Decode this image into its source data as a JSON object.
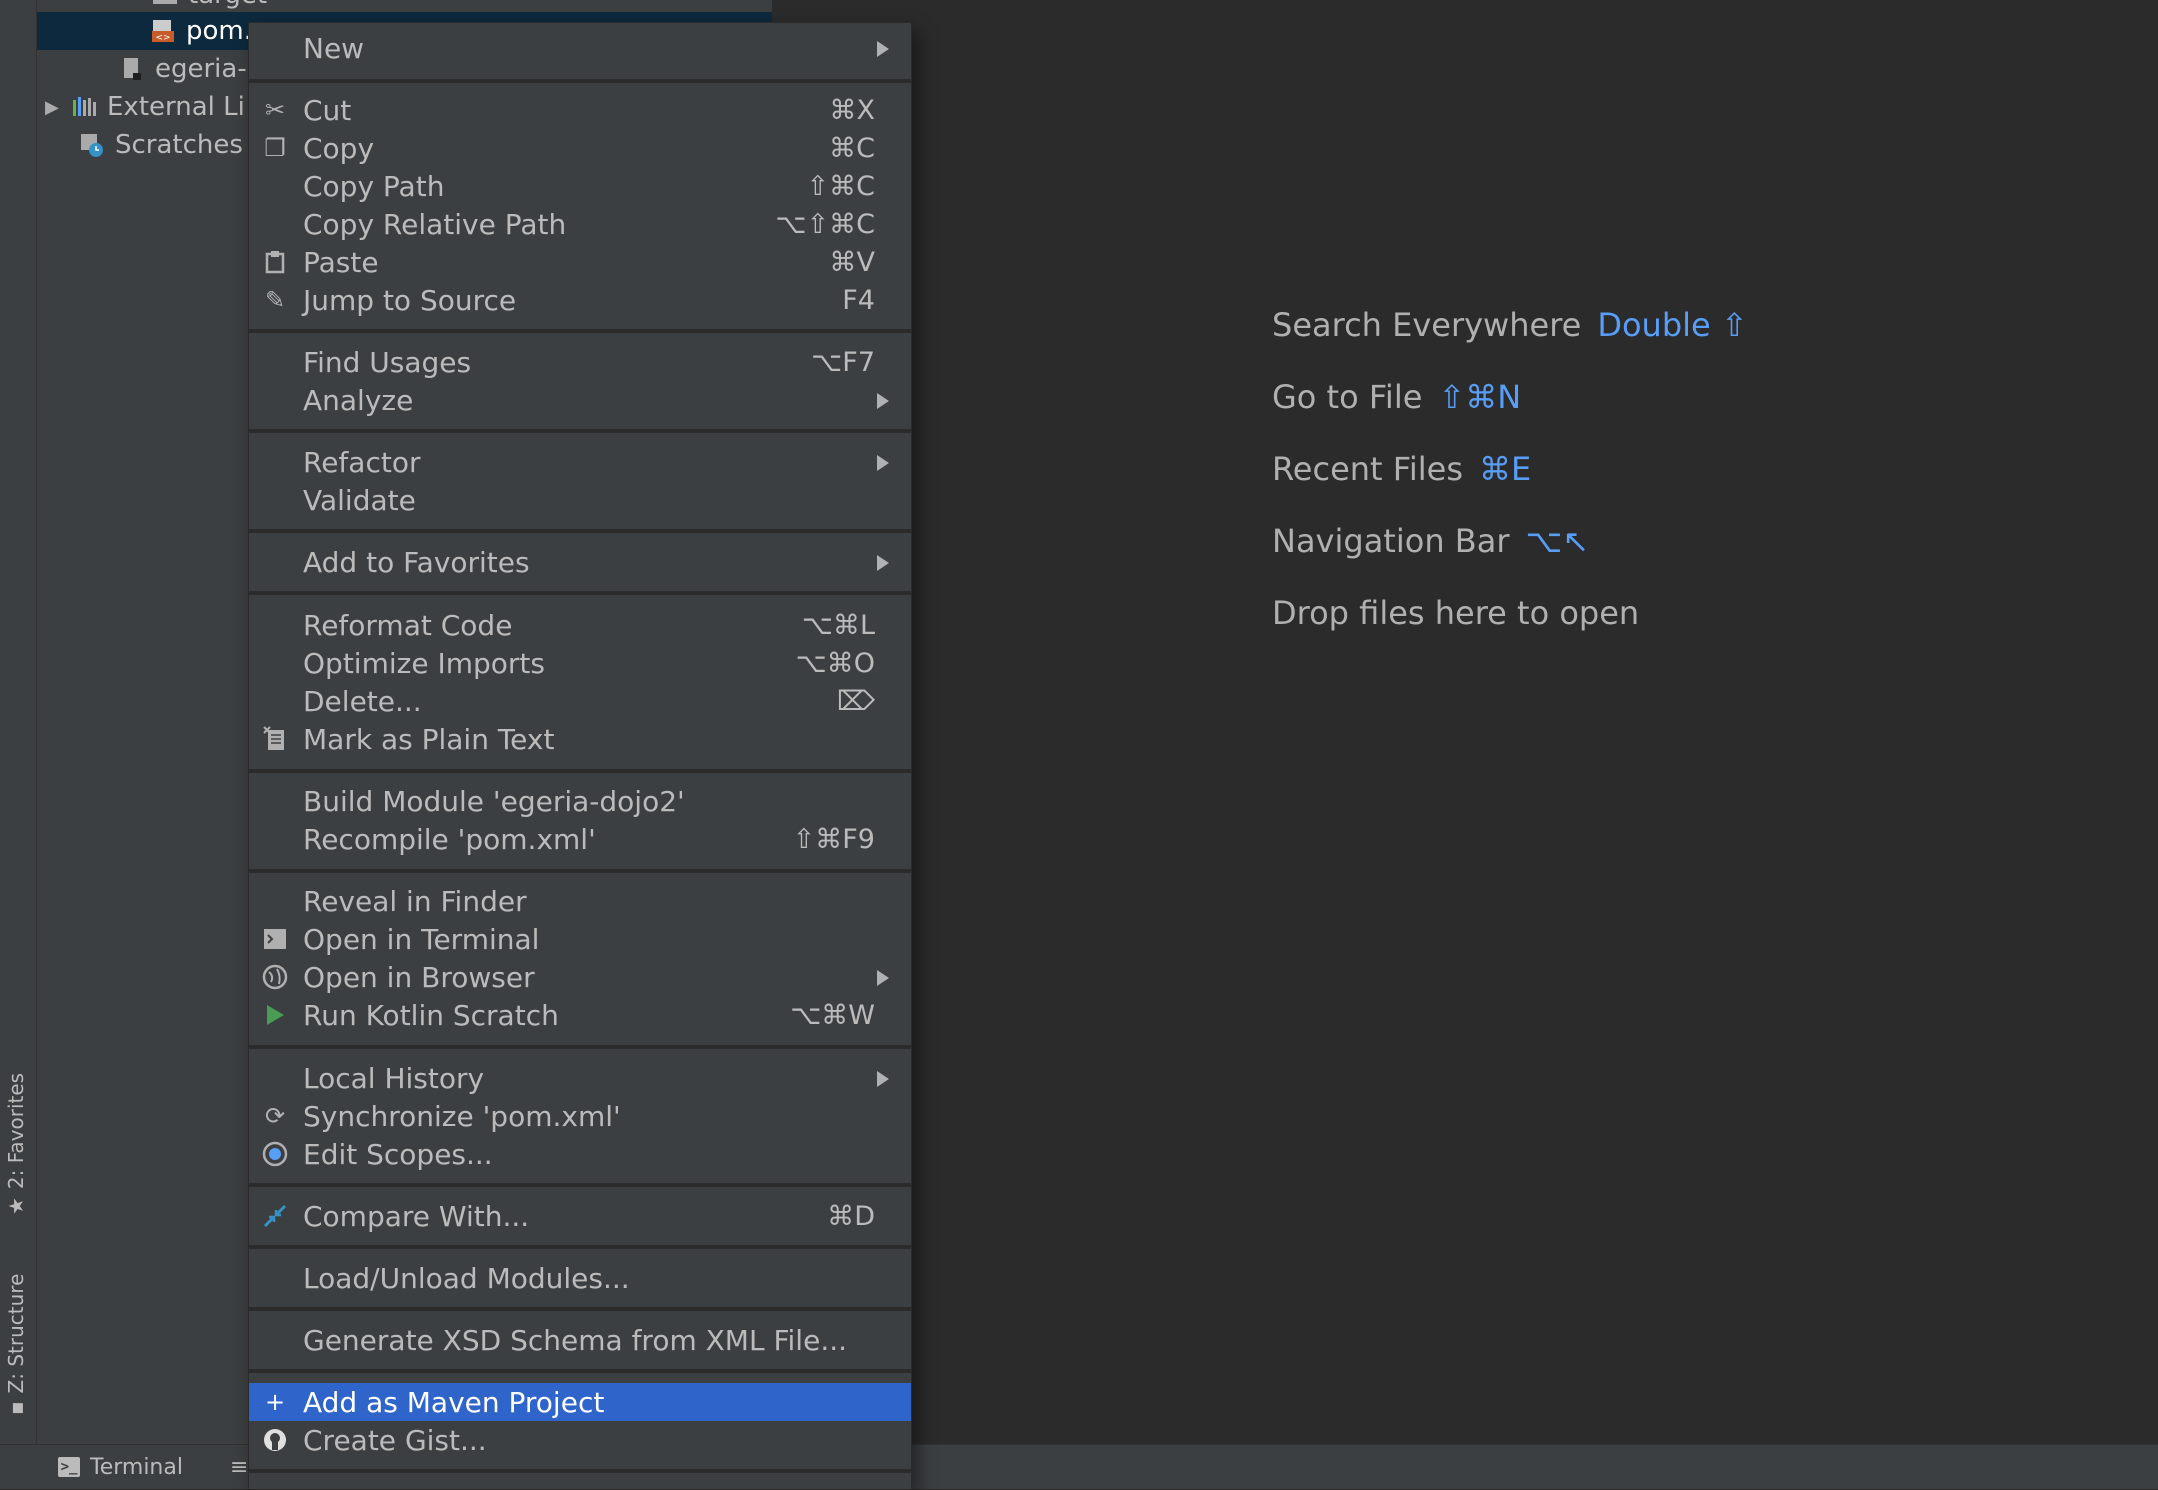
{
  "tool_strip": {
    "favorites_label": "2: Favorites",
    "structure_label": "Z: Structure"
  },
  "project_tree": {
    "items": [
      {
        "label": "target",
        "icon": "folder-icon"
      },
      {
        "label": "pom.",
        "icon": "maven-pom-icon"
      },
      {
        "label": "egeria-",
        "icon": "module-file-icon"
      },
      {
        "label": "External Li",
        "icon": "library-icon"
      },
      {
        "label": "Scratches",
        "icon": "scratches-icon"
      }
    ]
  },
  "context_menu": {
    "items": [
      {
        "label": "New",
        "submenu": true
      },
      {
        "label": "Cut",
        "shortcut": "⌘X",
        "icon": "scissors-icon"
      },
      {
        "label": "Copy",
        "shortcut": "⌘C",
        "icon": "copy-icon"
      },
      {
        "label": "Copy Path",
        "shortcut": "⇧⌘C"
      },
      {
        "label": "Copy Relative Path",
        "shortcut": "⌥⇧⌘C"
      },
      {
        "label": "Paste",
        "shortcut": "⌘V",
        "icon": "clipboard-icon"
      },
      {
        "label": "Jump to Source",
        "shortcut": "F4",
        "icon": "pencil-icon"
      },
      {
        "label": "Find Usages",
        "shortcut": "⌥F7"
      },
      {
        "label": "Analyze",
        "submenu": true
      },
      {
        "label": "Refactor",
        "submenu": true
      },
      {
        "label": "Validate"
      },
      {
        "label": "Add to Favorites",
        "submenu": true
      },
      {
        "label": "Reformat Code",
        "shortcut": "⌥⌘L"
      },
      {
        "label": "Optimize Imports",
        "shortcut": "⌥⌘O"
      },
      {
        "label": "Delete...",
        "shortcut": "⌦"
      },
      {
        "label": "Mark as Plain Text",
        "icon": "plain-text-icon"
      },
      {
        "label": "Build Module 'egeria-dojo2'"
      },
      {
        "label": "Recompile 'pom.xml'",
        "shortcut": "⇧⌘F9"
      },
      {
        "label": "Reveal in Finder"
      },
      {
        "label": "Open in Terminal",
        "icon": "terminal-icon"
      },
      {
        "label": "Open in Browser",
        "submenu": true,
        "icon": "globe-icon"
      },
      {
        "label": "Run Kotlin Scratch",
        "shortcut": "⌥⌘W",
        "icon": "run-icon"
      },
      {
        "label": "Local History",
        "submenu": true
      },
      {
        "label": "Synchronize 'pom.xml'",
        "icon": "sync-icon"
      },
      {
        "label": "Edit Scopes...",
        "icon": "scope-icon"
      },
      {
        "label": "Compare With...",
        "shortcut": "⌘D",
        "icon": "compare-icon"
      },
      {
        "label": "Load/Unload Modules..."
      },
      {
        "label": "Generate XSD Schema from XML File..."
      },
      {
        "label": "Add as Maven Project",
        "icon": "plus-icon",
        "selected": true
      },
      {
        "label": "Create Gist...",
        "icon": "github-icon"
      }
    ]
  },
  "editor_hints": {
    "search_everywhere": {
      "label": "Search Everywhere",
      "key": "Double ⇧"
    },
    "go_to_file": {
      "label": "Go to File",
      "key": "⇧⌘N"
    },
    "recent_files": {
      "label": "Recent Files",
      "key": "⌘E"
    },
    "navigation_bar": {
      "label": "Navigation Bar",
      "key": "⌥↖"
    },
    "drop_files": "Drop files here to open"
  },
  "bottom_bar": {
    "terminal_label": "Terminal"
  },
  "colors": {
    "accent_blue": "#589df6",
    "selection": "#2f65ca",
    "menu_bg": "#3c3f41",
    "editor_bg": "#2b2b2b"
  }
}
